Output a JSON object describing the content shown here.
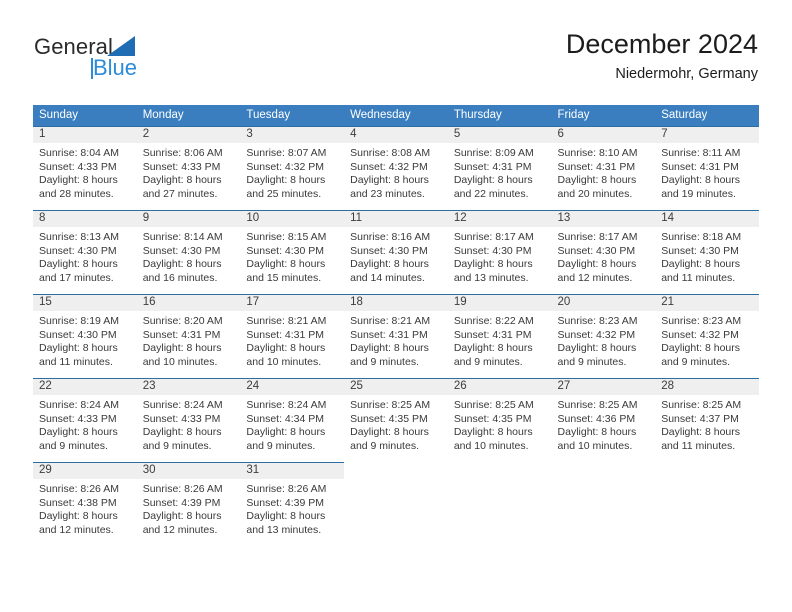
{
  "brand": {
    "name_top": "General",
    "name_bottom": "Blue",
    "triangle_color": "#1e6cb4",
    "blue_color": "#2e8bd8"
  },
  "header": {
    "title": "December 2024",
    "location": "Niedermohr, Germany"
  },
  "theme": {
    "header_band": "#3a7ebf",
    "row_rule": "#2e6da4",
    "daynum_band": "#efefef"
  },
  "weekdays": [
    "Sunday",
    "Monday",
    "Tuesday",
    "Wednesday",
    "Thursday",
    "Friday",
    "Saturday"
  ],
  "weeks": [
    [
      {
        "day": "1",
        "sunrise": "Sunrise: 8:04 AM",
        "sunset": "Sunset: 4:33 PM",
        "daylight1": "Daylight: 8 hours",
        "daylight2": "and 28 minutes."
      },
      {
        "day": "2",
        "sunrise": "Sunrise: 8:06 AM",
        "sunset": "Sunset: 4:33 PM",
        "daylight1": "Daylight: 8 hours",
        "daylight2": "and 27 minutes."
      },
      {
        "day": "3",
        "sunrise": "Sunrise: 8:07 AM",
        "sunset": "Sunset: 4:32 PM",
        "daylight1": "Daylight: 8 hours",
        "daylight2": "and 25 minutes."
      },
      {
        "day": "4",
        "sunrise": "Sunrise: 8:08 AM",
        "sunset": "Sunset: 4:32 PM",
        "daylight1": "Daylight: 8 hours",
        "daylight2": "and 23 minutes."
      },
      {
        "day": "5",
        "sunrise": "Sunrise: 8:09 AM",
        "sunset": "Sunset: 4:31 PM",
        "daylight1": "Daylight: 8 hours",
        "daylight2": "and 22 minutes."
      },
      {
        "day": "6",
        "sunrise": "Sunrise: 8:10 AM",
        "sunset": "Sunset: 4:31 PM",
        "daylight1": "Daylight: 8 hours",
        "daylight2": "and 20 minutes."
      },
      {
        "day": "7",
        "sunrise": "Sunrise: 8:11 AM",
        "sunset": "Sunset: 4:31 PM",
        "daylight1": "Daylight: 8 hours",
        "daylight2": "and 19 minutes."
      }
    ],
    [
      {
        "day": "8",
        "sunrise": "Sunrise: 8:13 AM",
        "sunset": "Sunset: 4:30 PM",
        "daylight1": "Daylight: 8 hours",
        "daylight2": "and 17 minutes."
      },
      {
        "day": "9",
        "sunrise": "Sunrise: 8:14 AM",
        "sunset": "Sunset: 4:30 PM",
        "daylight1": "Daylight: 8 hours",
        "daylight2": "and 16 minutes."
      },
      {
        "day": "10",
        "sunrise": "Sunrise: 8:15 AM",
        "sunset": "Sunset: 4:30 PM",
        "daylight1": "Daylight: 8 hours",
        "daylight2": "and 15 minutes."
      },
      {
        "day": "11",
        "sunrise": "Sunrise: 8:16 AM",
        "sunset": "Sunset: 4:30 PM",
        "daylight1": "Daylight: 8 hours",
        "daylight2": "and 14 minutes."
      },
      {
        "day": "12",
        "sunrise": "Sunrise: 8:17 AM",
        "sunset": "Sunset: 4:30 PM",
        "daylight1": "Daylight: 8 hours",
        "daylight2": "and 13 minutes."
      },
      {
        "day": "13",
        "sunrise": "Sunrise: 8:17 AM",
        "sunset": "Sunset: 4:30 PM",
        "daylight1": "Daylight: 8 hours",
        "daylight2": "and 12 minutes."
      },
      {
        "day": "14",
        "sunrise": "Sunrise: 8:18 AM",
        "sunset": "Sunset: 4:30 PM",
        "daylight1": "Daylight: 8 hours",
        "daylight2": "and 11 minutes."
      }
    ],
    [
      {
        "day": "15",
        "sunrise": "Sunrise: 8:19 AM",
        "sunset": "Sunset: 4:30 PM",
        "daylight1": "Daylight: 8 hours",
        "daylight2": "and 11 minutes."
      },
      {
        "day": "16",
        "sunrise": "Sunrise: 8:20 AM",
        "sunset": "Sunset: 4:31 PM",
        "daylight1": "Daylight: 8 hours",
        "daylight2": "and 10 minutes."
      },
      {
        "day": "17",
        "sunrise": "Sunrise: 8:21 AM",
        "sunset": "Sunset: 4:31 PM",
        "daylight1": "Daylight: 8 hours",
        "daylight2": "and 10 minutes."
      },
      {
        "day": "18",
        "sunrise": "Sunrise: 8:21 AM",
        "sunset": "Sunset: 4:31 PM",
        "daylight1": "Daylight: 8 hours",
        "daylight2": "and 9 minutes."
      },
      {
        "day": "19",
        "sunrise": "Sunrise: 8:22 AM",
        "sunset": "Sunset: 4:31 PM",
        "daylight1": "Daylight: 8 hours",
        "daylight2": "and 9 minutes."
      },
      {
        "day": "20",
        "sunrise": "Sunrise: 8:23 AM",
        "sunset": "Sunset: 4:32 PM",
        "daylight1": "Daylight: 8 hours",
        "daylight2": "and 9 minutes."
      },
      {
        "day": "21",
        "sunrise": "Sunrise: 8:23 AM",
        "sunset": "Sunset: 4:32 PM",
        "daylight1": "Daylight: 8 hours",
        "daylight2": "and 9 minutes."
      }
    ],
    [
      {
        "day": "22",
        "sunrise": "Sunrise: 8:24 AM",
        "sunset": "Sunset: 4:33 PM",
        "daylight1": "Daylight: 8 hours",
        "daylight2": "and 9 minutes."
      },
      {
        "day": "23",
        "sunrise": "Sunrise: 8:24 AM",
        "sunset": "Sunset: 4:33 PM",
        "daylight1": "Daylight: 8 hours",
        "daylight2": "and 9 minutes."
      },
      {
        "day": "24",
        "sunrise": "Sunrise: 8:24 AM",
        "sunset": "Sunset: 4:34 PM",
        "daylight1": "Daylight: 8 hours",
        "daylight2": "and 9 minutes."
      },
      {
        "day": "25",
        "sunrise": "Sunrise: 8:25 AM",
        "sunset": "Sunset: 4:35 PM",
        "daylight1": "Daylight: 8 hours",
        "daylight2": "and 9 minutes."
      },
      {
        "day": "26",
        "sunrise": "Sunrise: 8:25 AM",
        "sunset": "Sunset: 4:35 PM",
        "daylight1": "Daylight: 8 hours",
        "daylight2": "and 10 minutes."
      },
      {
        "day": "27",
        "sunrise": "Sunrise: 8:25 AM",
        "sunset": "Sunset: 4:36 PM",
        "daylight1": "Daylight: 8 hours",
        "daylight2": "and 10 minutes."
      },
      {
        "day": "28",
        "sunrise": "Sunrise: 8:25 AM",
        "sunset": "Sunset: 4:37 PM",
        "daylight1": "Daylight: 8 hours",
        "daylight2": "and 11 minutes."
      }
    ],
    [
      {
        "day": "29",
        "sunrise": "Sunrise: 8:26 AM",
        "sunset": "Sunset: 4:38 PM",
        "daylight1": "Daylight: 8 hours",
        "daylight2": "and 12 minutes."
      },
      {
        "day": "30",
        "sunrise": "Sunrise: 8:26 AM",
        "sunset": "Sunset: 4:39 PM",
        "daylight1": "Daylight: 8 hours",
        "daylight2": "and 12 minutes."
      },
      {
        "day": "31",
        "sunrise": "Sunrise: 8:26 AM",
        "sunset": "Sunset: 4:39 PM",
        "daylight1": "Daylight: 8 hours",
        "daylight2": "and 13 minutes."
      },
      null,
      null,
      null,
      null
    ]
  ]
}
